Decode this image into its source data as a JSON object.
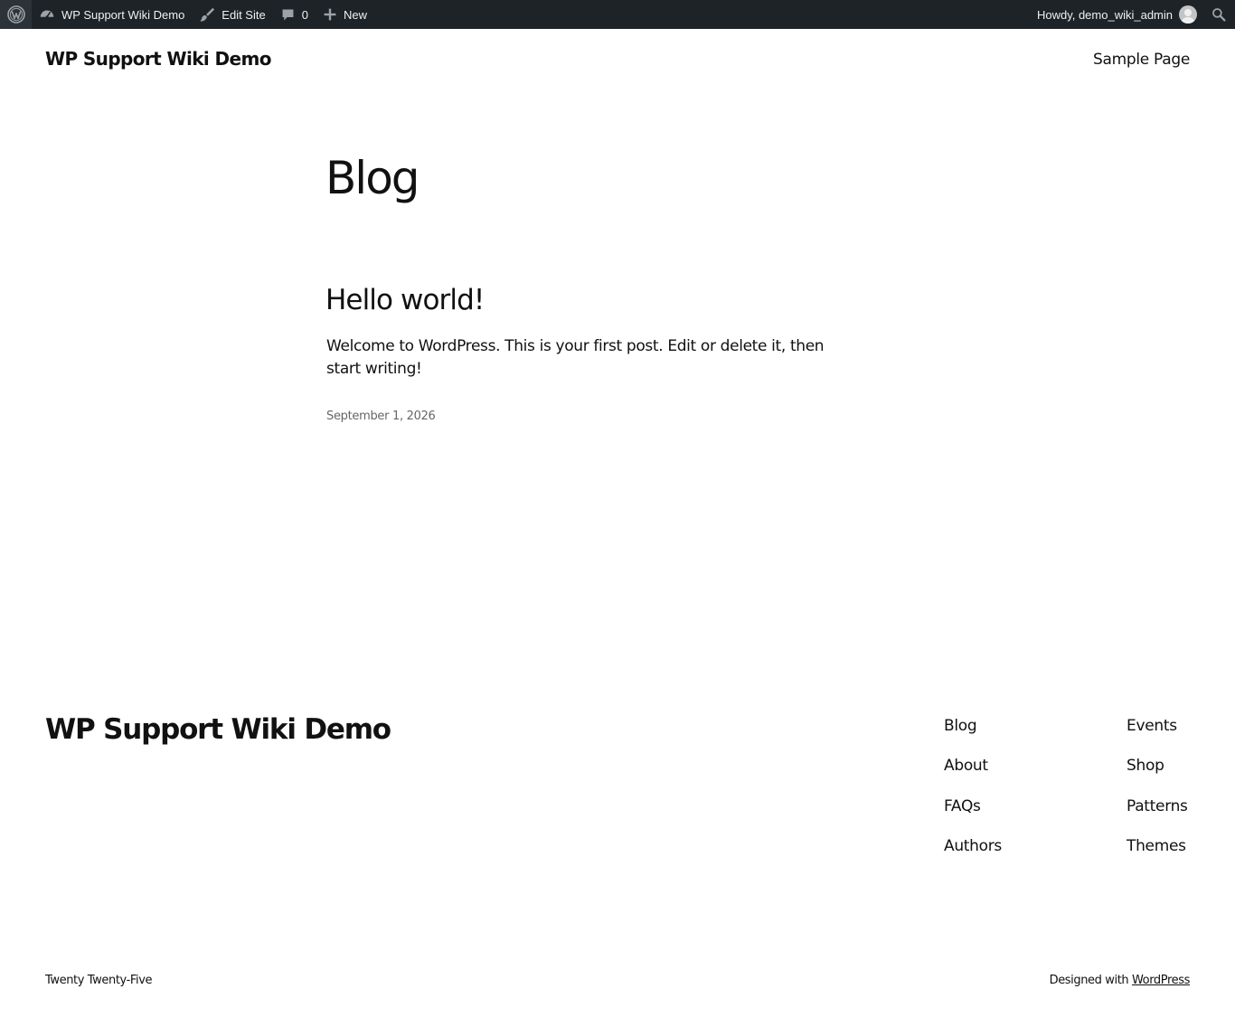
{
  "admin_bar": {
    "site_name": "WP Support Wiki Demo",
    "edit_site": "Edit Site",
    "comments_count": "0",
    "new_label": "New",
    "howdy": "Howdy, demo_wiki_admin"
  },
  "header": {
    "site_title": "WP Support Wiki Demo",
    "nav_item": "Sample Page"
  },
  "main": {
    "page_title": "Blog",
    "post": {
      "title": "Hello world!",
      "excerpt": "Welcome to WordPress. This is your first post. Edit or delete it, then start writing!",
      "date": "September 1, 2026"
    }
  },
  "footer": {
    "site_title": "WP Support Wiki Demo",
    "nav_col1": [
      "Blog",
      "About",
      "FAQs",
      "Authors"
    ],
    "nav_col2": [
      "Events",
      "Shop",
      "Patterns",
      "Themes"
    ],
    "theme_name": "Twenty Twenty-Five",
    "designed_with": "Designed with",
    "wordpress_link": "WordPress"
  },
  "colors": {
    "admin_bar_bg": "#1d2327",
    "text": "#111111",
    "meta_text": "#666666"
  }
}
